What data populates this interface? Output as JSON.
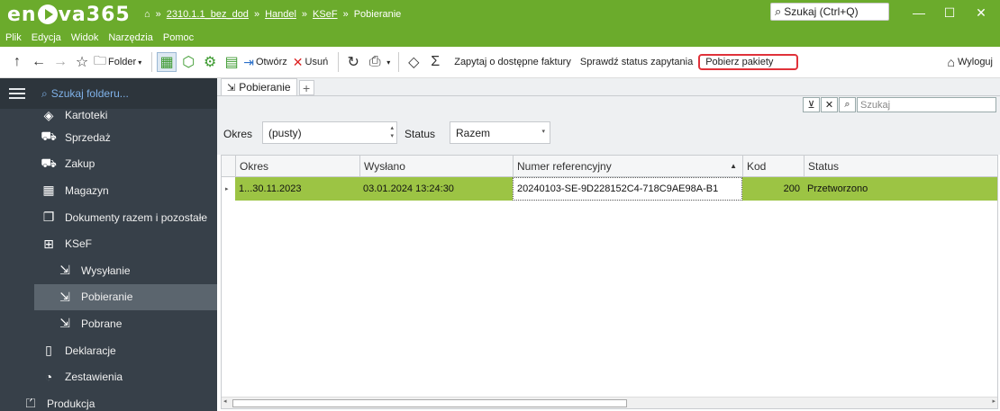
{
  "app": {
    "logo": {
      "pre": "en",
      "post": "va365"
    },
    "breadcrumb": [
      "2310.1.1_bez_dod",
      "Handel",
      "KSeF",
      "Pobieranie"
    ],
    "search_placeholder": "Szukaj (Ctrl+Q)"
  },
  "menu": [
    "Plik",
    "Edycja",
    "Widok",
    "Narzędzia",
    "Pomoc"
  ],
  "toolbar": {
    "folder": "Folder",
    "otworz": "Otwórz",
    "usun": "Usuń",
    "zapytaj": "Zapytaj o dostępne faktury",
    "sprawdz": "Sprawdź status zapytania",
    "pobierz": "Pobierz pakiety",
    "wyloguj": "Wyloguj"
  },
  "sidebar": {
    "search_placeholder": "Szukaj folderu...",
    "items": [
      {
        "label": "Kartoteki"
      },
      {
        "label": "Sprzedaż"
      },
      {
        "label": "Zakup"
      },
      {
        "label": "Magazyn"
      },
      {
        "label": "Dokumenty razem i pozostałe"
      },
      {
        "label": "KSeF"
      },
      {
        "label": "Wysyłanie"
      },
      {
        "label": "Pobieranie"
      },
      {
        "label": "Pobrane"
      },
      {
        "label": "Deklaracje"
      },
      {
        "label": "Zestawienia"
      },
      {
        "label": "Produkcja"
      }
    ]
  },
  "tab": {
    "label": "Pobieranie"
  },
  "filters": {
    "search_placeholder": "Szukaj",
    "okres_label": "Okres",
    "okres_value": "(pusty)",
    "status_label": "Status",
    "status_value": "Razem"
  },
  "grid": {
    "columns": [
      "Okres",
      "Wysłano",
      "Numer referencyjny",
      "Kod",
      "Status"
    ],
    "rows": [
      {
        "okres": "1...30.11.2023",
        "wyslano": "03.01.2024 13:24:30",
        "numer": "20240103-SE-9D228152C4-718C9AE98A-B1",
        "kod": "200",
        "status": "Przetworzono"
      }
    ]
  }
}
